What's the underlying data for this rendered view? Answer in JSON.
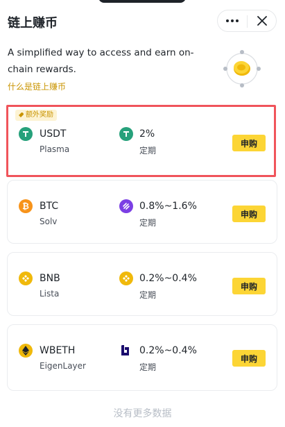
{
  "header": {
    "title": "链上赚币",
    "more_icon": "more-dots-icon",
    "close_icon": "close-icon"
  },
  "intro": {
    "description": "A simplified way to access and earn on-chain rewards.",
    "link_text": "什么是链上赚币",
    "link_color": "#c99400"
  },
  "colors": {
    "accent": "#fcd535",
    "highlight_border": "#f0545b",
    "muted_text": "#b7bdc6"
  },
  "products": [
    {
      "badge": "额外奖励",
      "asset": "USDT",
      "network": "Plasma",
      "asset_icon": "tether-icon",
      "rate_icon": "tether-icon",
      "rate": "2%",
      "term": "定期",
      "button": "申购",
      "highlighted": true
    },
    {
      "asset": "BTC",
      "network": "Solv",
      "asset_icon": "bitcoin-icon",
      "rate_icon": "solv-icon",
      "rate": "0.8%~1.6%",
      "term": "定期",
      "button": "申购"
    },
    {
      "asset": "BNB",
      "network": "Lista",
      "asset_icon": "bnb-icon",
      "rate_icon": "bnb-icon",
      "rate": "0.2%~0.4%",
      "term": "定期",
      "button": "申购"
    },
    {
      "asset": "WBETH",
      "network": "EigenLayer",
      "asset_icon": "wbeth-icon",
      "rate_icon": "eigenlayer-icon",
      "rate": "0.2%~0.4%",
      "term": "定期",
      "button": "申购"
    }
  ],
  "footer": {
    "no_more": "没有更多数据"
  }
}
